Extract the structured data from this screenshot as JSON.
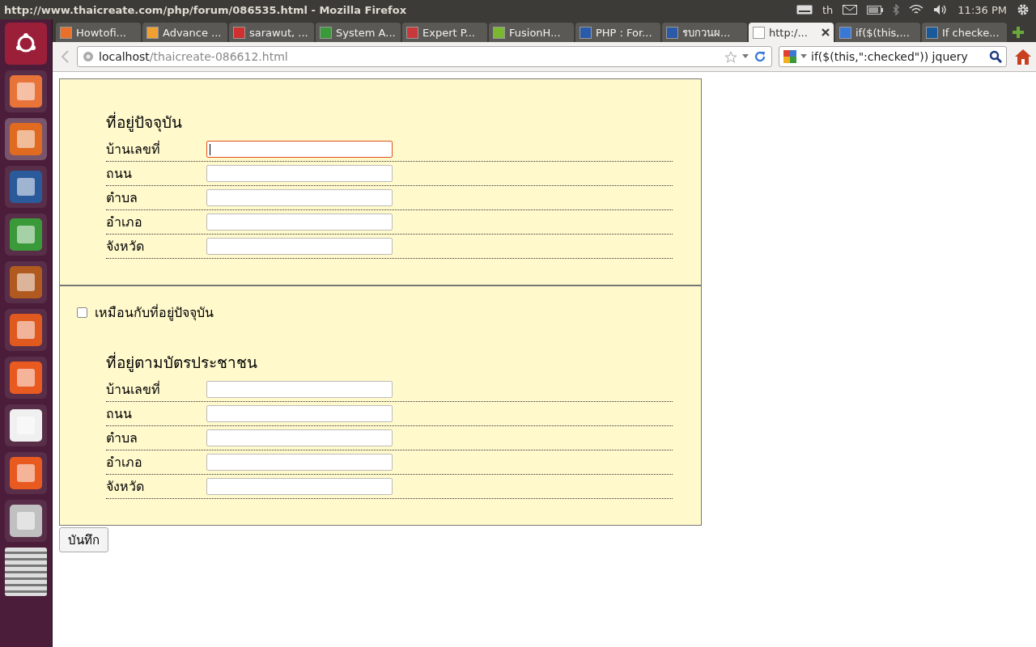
{
  "window": {
    "title": "http://www.thaicreate.com/php/forum/086535.html - Mozilla Firefox"
  },
  "top_panel": {
    "keyboard": "th",
    "time": "11:36 PM"
  },
  "tabs": [
    {
      "label": "Howtofi...",
      "selected": false,
      "color": "#e8702a"
    },
    {
      "label": "Advance ...",
      "selected": false,
      "color": "#f0a030"
    },
    {
      "label": "sarawut, ...",
      "selected": false,
      "color": "#d03030"
    },
    {
      "label": "System A...",
      "selected": false,
      "color": "#3a9a3a"
    },
    {
      "label": "Expert P...",
      "selected": false,
      "color": "#c83a3a"
    },
    {
      "label": "FusionH...",
      "selected": false,
      "color": "#7ab830"
    },
    {
      "label": "PHP : For...",
      "selected": false,
      "color": "#2a5aa8"
    },
    {
      "label": "รบกวนผ...",
      "selected": false,
      "color": "#2a5aa8"
    },
    {
      "label": "http:/...",
      "selected": true,
      "color": "#ffffff"
    },
    {
      "label": "if($(this,...",
      "selected": false,
      "color": "#3a78d8"
    },
    {
      "label": "If checke...",
      "selected": false,
      "color": "#1a5a9a"
    }
  ],
  "address": {
    "host": "localhost",
    "path": "/thaicreate-086612.html"
  },
  "search": {
    "value": "if($(this,\":checked\")) jquery"
  },
  "sections": [
    {
      "heading": "ที่อยู่ปัจจุบัน",
      "fields": [
        {
          "label": "บ้านเลขที่",
          "focused": true
        },
        {
          "label": "ถนน",
          "focused": false
        },
        {
          "label": "ตำบล",
          "focused": false
        },
        {
          "label": "อำเภอ",
          "focused": false
        },
        {
          "label": "จังหวัด",
          "focused": false
        }
      ]
    },
    {
      "heading": "ที่อยู่ตามบัตรประชาชน",
      "checkbox": {
        "label": "เหมือนกับที่อยู่ปัจจุบัน",
        "checked": false
      },
      "fields": [
        {
          "label": "บ้านเลขที่",
          "focused": false
        },
        {
          "label": "ถนน",
          "focused": false
        },
        {
          "label": "ตำบล",
          "focused": false
        },
        {
          "label": "อำเภอ",
          "focused": false
        },
        {
          "label": "จังหวัด",
          "focused": false
        }
      ]
    }
  ],
  "submit": {
    "label": "บันทึก"
  }
}
